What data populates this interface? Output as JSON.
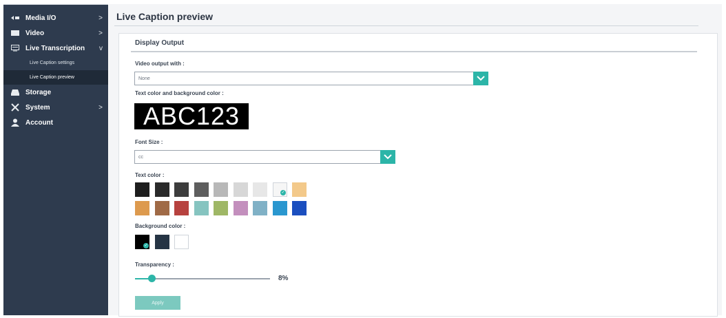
{
  "sidebar": {
    "items": [
      {
        "label": "Media I/O",
        "icon": "media-io-icon",
        "chevron": ">"
      },
      {
        "label": "Video",
        "icon": "video-icon",
        "chevron": ">"
      },
      {
        "label": "Live Transcription",
        "icon": "transcription-icon",
        "chevron": "v"
      },
      {
        "label": "Storage",
        "icon": "storage-icon",
        "chevron": ""
      },
      {
        "label": "System",
        "icon": "system-icon",
        "chevron": ">"
      },
      {
        "label": "Account",
        "icon": "account-icon",
        "chevron": ""
      }
    ],
    "sub_items": [
      {
        "label": "Live Caption settings",
        "active": false
      },
      {
        "label": "Live Caption preview",
        "active": true
      }
    ]
  },
  "header": {
    "title": "Live Caption preview"
  },
  "display_output": {
    "section_title": "Display Output",
    "video_output_label": "Video output with :",
    "video_output_value": "None",
    "text_bg_label": "Text color and background color :",
    "preview_text": "ABC123",
    "font_size_label": "Font Size :",
    "font_size_value": "cc",
    "text_color_label": "Text color :",
    "background_color_label": "Background color :",
    "transparency_label": "Transparency :",
    "transparency_value": "8%",
    "transparency_fraction": 0.08,
    "apply_label": "Apply"
  },
  "colors": {
    "accent": "#2cb5a8",
    "sidebar_bg": "#2e3b4e",
    "text_colors_row1": [
      "#1e1e1e",
      "#2a2a2a",
      "#3d3d3d",
      "#5e5e5e",
      "#b8b8b8",
      "#d7d7d7",
      "#e7e7e7",
      "#f6f6f6",
      "#f3c98a"
    ],
    "text_colors_row2": [
      "#dd9a4e",
      "#a06a46",
      "#b7423f",
      "#86c4c0",
      "#9fb766",
      "#c38fbd",
      "#80b1c6",
      "#2a97cf",
      "#1b4fbf"
    ],
    "text_color_selected_index": 7,
    "background_colors": [
      "#000000",
      "#253444",
      "#ffffff"
    ],
    "background_selected_index": 0
  }
}
